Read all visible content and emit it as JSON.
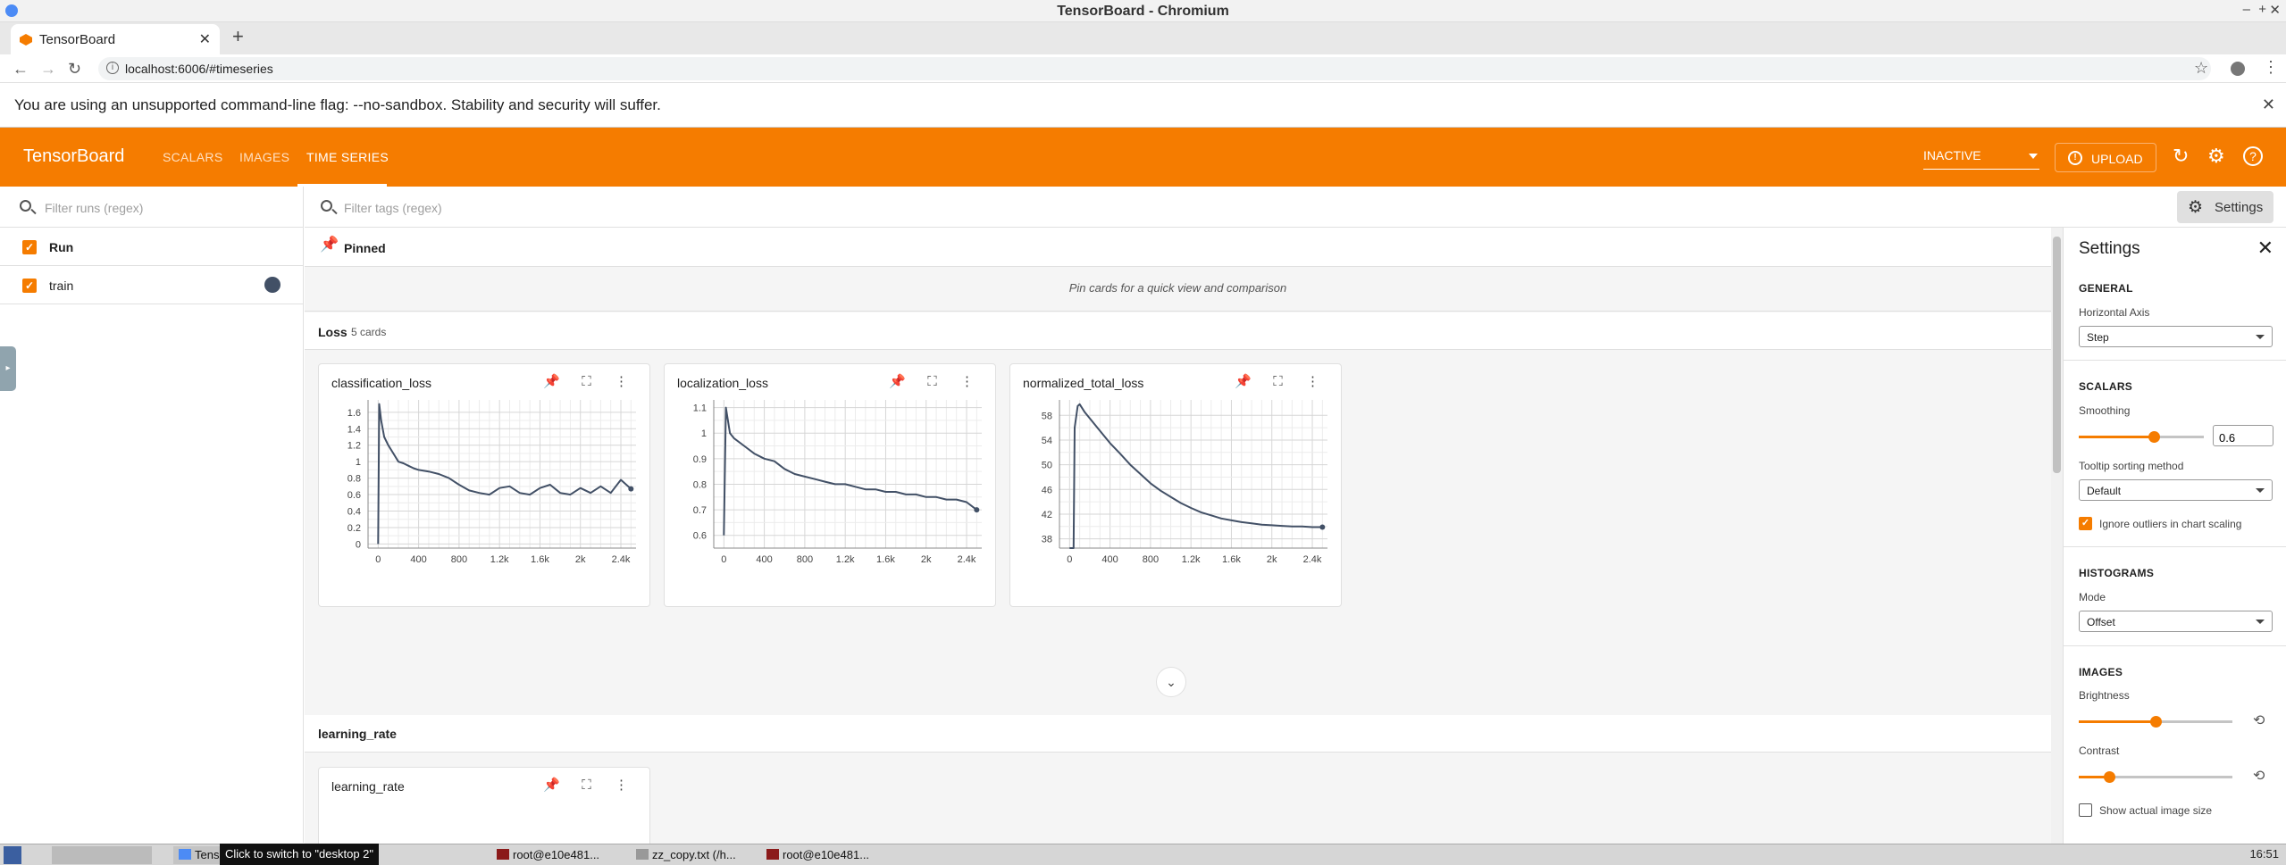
{
  "window": {
    "title": "TensorBoard - Chromium"
  },
  "browser": {
    "tab_title": "TensorBoard",
    "url": "localhost:6006/#timeseries",
    "infobar": "You are using an unsupported command-line flag: --no-sandbox. Stability and security will suffer."
  },
  "toolbar": {
    "brand": "TensorBoard",
    "tabs": [
      "SCALARS",
      "IMAGES",
      "TIME SERIES"
    ],
    "active_tab": "TIME SERIES",
    "reload_status": "INACTIVE",
    "upload_label": "UPLOAD",
    "accent_color": "#f57c00"
  },
  "sidebar": {
    "filter_placeholder": "Filter runs (regex)",
    "runs": [
      {
        "label": "Run",
        "checked": true
      },
      {
        "label": "train",
        "checked": true,
        "color": "#425066"
      }
    ]
  },
  "main": {
    "tag_filter_placeholder": "Filter tags (regex)",
    "settings_button": "Settings",
    "pinned_title": "Pinned",
    "pinned_message": "Pin cards for a quick view and comparison",
    "groups": [
      {
        "name": "Loss",
        "count_label": "5 cards"
      },
      {
        "name": "learning_rate"
      }
    ],
    "learning_rate_card_title": "learning_rate"
  },
  "chart_data": [
    {
      "type": "line",
      "title": "classification_loss",
      "xlabel": "",
      "ylabel": "",
      "x_ticks": [
        "0",
        "400",
        "800",
        "1.2k",
        "1.6k",
        "2k",
        "2.4k"
      ],
      "y_ticks": [
        "0",
        "0.2",
        "0.4",
        "0.6",
        "0.8",
        "1",
        "1.2",
        "1.4",
        "1.6"
      ],
      "xlim": [
        -100,
        2550
      ],
      "ylim": [
        -0.05,
        1.75
      ],
      "grid": true,
      "series": [
        {
          "x": [
            0,
            10,
            30,
            60,
            100,
            150,
            200,
            250,
            300,
            350,
            400,
            500,
            600,
            700,
            800,
            900,
            1000,
            1100,
            1200,
            1300,
            1400,
            1500,
            1600,
            1700,
            1800,
            1900,
            2000,
            2100,
            2200,
            2300,
            2400,
            2500
          ],
          "y": [
            0.0,
            1.7,
            1.5,
            1.3,
            1.2,
            1.1,
            1.0,
            0.98,
            0.95,
            0.92,
            0.9,
            0.88,
            0.85,
            0.8,
            0.72,
            0.65,
            0.62,
            0.6,
            0.68,
            0.7,
            0.62,
            0.6,
            0.68,
            0.72,
            0.62,
            0.6,
            0.68,
            0.62,
            0.7,
            0.62,
            0.78,
            0.67
          ]
        }
      ]
    },
    {
      "type": "line",
      "title": "localization_loss",
      "xlabel": "",
      "ylabel": "",
      "x_ticks": [
        "0",
        "400",
        "800",
        "1.2k",
        "1.6k",
        "2k",
        "2.4k"
      ],
      "y_ticks": [
        "0.6",
        "0.7",
        "0.8",
        "0.9",
        "1",
        "1.1"
      ],
      "xlim": [
        -100,
        2550
      ],
      "ylim": [
        0.55,
        1.13
      ],
      "grid": true,
      "series": [
        {
          "x": [
            0,
            20,
            60,
            100,
            200,
            300,
            400,
            500,
            600,
            700,
            800,
            900,
            1000,
            1100,
            1200,
            1300,
            1400,
            1500,
            1600,
            1700,
            1800,
            1900,
            2000,
            2100,
            2200,
            2300,
            2400,
            2500
          ],
          "y": [
            0.6,
            1.1,
            1.0,
            0.98,
            0.95,
            0.92,
            0.9,
            0.89,
            0.86,
            0.84,
            0.83,
            0.82,
            0.81,
            0.8,
            0.8,
            0.79,
            0.78,
            0.78,
            0.77,
            0.77,
            0.76,
            0.76,
            0.75,
            0.75,
            0.74,
            0.74,
            0.73,
            0.7
          ]
        }
      ]
    },
    {
      "type": "line",
      "title": "normalized_total_loss",
      "xlabel": "",
      "ylabel": "",
      "x_ticks": [
        "0",
        "400",
        "800",
        "1.2k",
        "1.6k",
        "2k",
        "2.4k"
      ],
      "y_ticks": [
        "38",
        "42",
        "46",
        "50",
        "54",
        "58"
      ],
      "xlim": [
        -100,
        2550
      ],
      "ylim": [
        36.5,
        60.5
      ],
      "grid": true,
      "series": [
        {
          "x": [
            0,
            40,
            50,
            80,
            100,
            150,
            200,
            300,
            400,
            500,
            600,
            700,
            800,
            900,
            1000,
            1100,
            1200,
            1300,
            1400,
            1500,
            1600,
            1700,
            1800,
            1900,
            2000,
            2100,
            2200,
            2300,
            2400,
            2500
          ],
          "y": [
            36.5,
            36.5,
            56,
            59.5,
            59.8,
            58.5,
            57.5,
            55.5,
            53.5,
            51.8,
            50.0,
            48.5,
            47.0,
            45.8,
            44.8,
            43.8,
            43.0,
            42.3,
            41.8,
            41.3,
            41.0,
            40.7,
            40.5,
            40.3,
            40.2,
            40.1,
            40.0,
            40.0,
            39.9,
            39.9
          ]
        }
      ]
    }
  ],
  "settings": {
    "title": "Settings",
    "general_header": "GENERAL",
    "horizontal_axis_label": "Horizontal Axis",
    "horizontal_axis_value": "Step",
    "scalars_header": "SCALARS",
    "smoothing_label": "Smoothing",
    "smoothing_value": "0.6",
    "smoothing_fraction": 0.6,
    "tooltip_sort_label": "Tooltip sorting method",
    "tooltip_sort_value": "Default",
    "ignore_outliers_label": "Ignore outliers in chart scaling",
    "ignore_outliers_checked": true,
    "histograms_header": "HISTOGRAMS",
    "mode_label": "Mode",
    "mode_value": "Offset",
    "images_header": "IMAGES",
    "brightness_label": "Brightness",
    "brightness_fraction": 0.5,
    "contrast_label": "Contrast",
    "contrast_fraction": 0.2,
    "actual_size_label": "Show actual image size",
    "actual_size_checked": false
  },
  "taskbar": {
    "tooltip": "Click to switch to \"desktop 2\"",
    "items": [
      "TensorBoard - ...",
      "root@e10e481...",
      "zz_copy.txt (/h...",
      "root@e10e481..."
    ],
    "clock": "16:51"
  }
}
